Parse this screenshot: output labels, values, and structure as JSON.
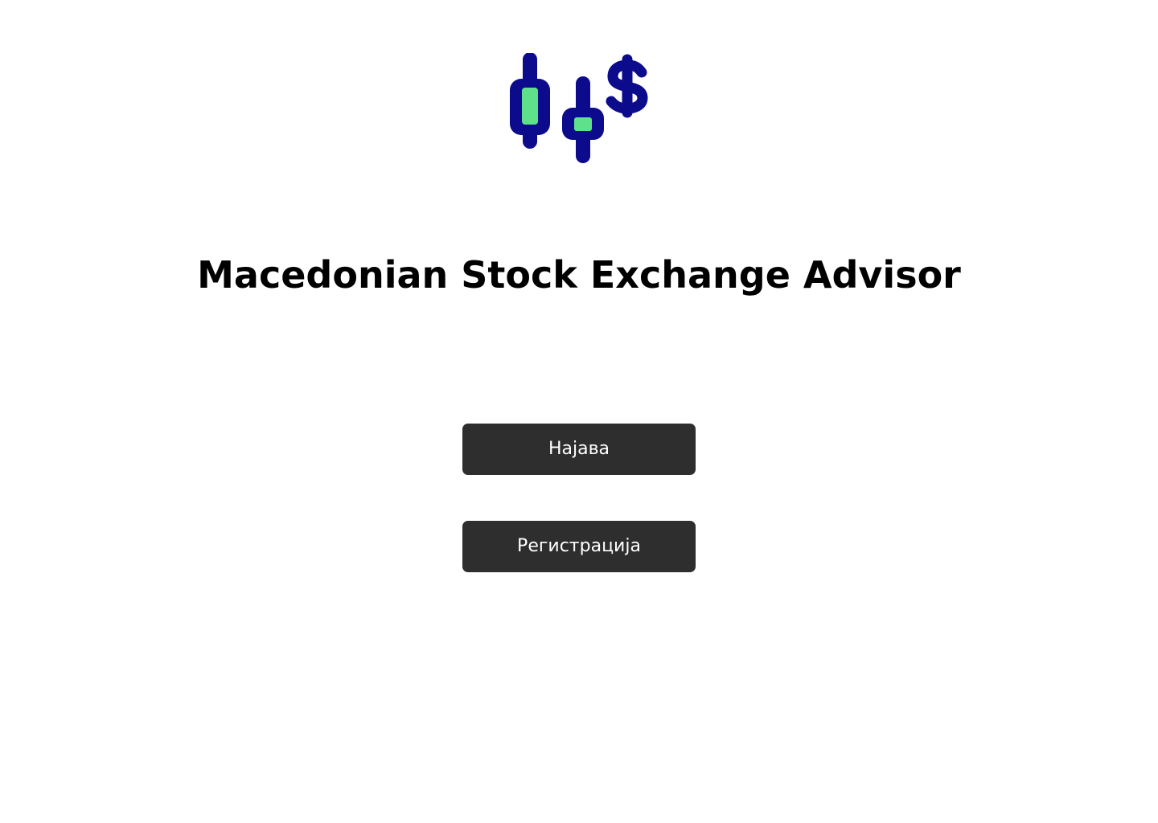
{
  "app": {
    "title": "Macedonian Stock Exchange Advisor",
    "logo_icon": "candlestick-dollar-icon"
  },
  "actions": {
    "login_label": "Најава",
    "register_label": "Регистрација"
  },
  "colors": {
    "logo_primary": "#0b0b8c",
    "logo_accent": "#5fe08a",
    "button_background": "#2e2e2e",
    "button_text": "#ffffff",
    "title_text": "#000000"
  }
}
